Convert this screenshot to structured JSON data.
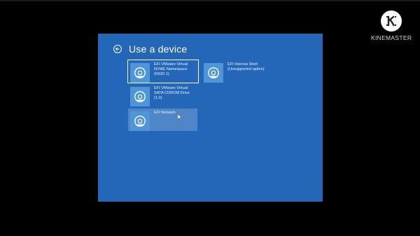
{
  "screen": {
    "title": "Use a device",
    "background": "#2466b8"
  },
  "devices": [
    {
      "label": "EFI VMware Virtual\nNVME Namespace\n(NSID 1)",
      "icon": "disc-icon",
      "state": "selected"
    },
    {
      "label": "EFI Internal Shell\n(Unsupported option)",
      "icon": "disc-icon",
      "state": "normal"
    },
    {
      "label": "EFI VMware Virtual\nSATA CDROM Drive\n(1.0)",
      "icon": "disc-icon",
      "state": "normal"
    },
    {
      "label": "EFI Network",
      "icon": "disc-icon",
      "state": "hover"
    }
  ],
  "watermark": {
    "text": "KINEMASTER",
    "logo_icon": "kinemaster-logo-icon"
  }
}
